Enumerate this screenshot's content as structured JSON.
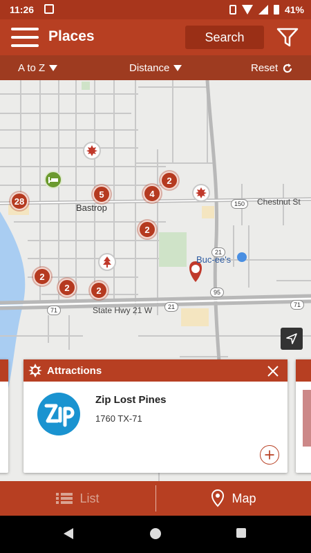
{
  "status_bar": {
    "time": "11:26",
    "battery": "41%"
  },
  "header": {
    "title": "Places",
    "search_label": "Search"
  },
  "sort_bar": {
    "sort_az": "A to Z",
    "sort_distance": "Distance",
    "reset": "Reset"
  },
  "map": {
    "town_label": "Bastrop",
    "street_label": "Chestnut St",
    "highway_label": "State Hwy 21 W",
    "store_label": "Buc-ee's",
    "shields": [
      "150",
      "21",
      "95",
      "21",
      "71",
      "71"
    ],
    "clusters": [
      "28",
      "5",
      "4",
      "2",
      "2",
      "2",
      "2",
      "2"
    ]
  },
  "card": {
    "category": "Attractions",
    "name": "Zip Lost Pines",
    "address": "1760 TX-71"
  },
  "tabs": {
    "list_label": "List",
    "map_label": "Map"
  },
  "colors": {
    "brand": "#b73f22",
    "brand_dark": "#9e3b20",
    "logo_blue": "#1a93d0"
  }
}
